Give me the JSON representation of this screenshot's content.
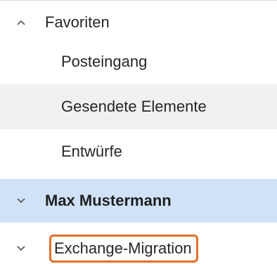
{
  "folder_tree": {
    "favorites": {
      "label": "Favoriten",
      "expanded": true,
      "items": [
        {
          "label": "Posteingang"
        },
        {
          "label": "Gesendete Elemente"
        },
        {
          "label": "Entwürfe"
        }
      ]
    },
    "accounts": [
      {
        "label": "Max Mustermann",
        "expanded": false,
        "selected": true
      },
      {
        "label": "Exchange-Migration",
        "expanded": false,
        "highlighted": true
      }
    ]
  },
  "colors": {
    "selected_row": "#cfe2f7",
    "hover_row": "#f1f1f1",
    "highlight_outline": "#e1702a"
  }
}
